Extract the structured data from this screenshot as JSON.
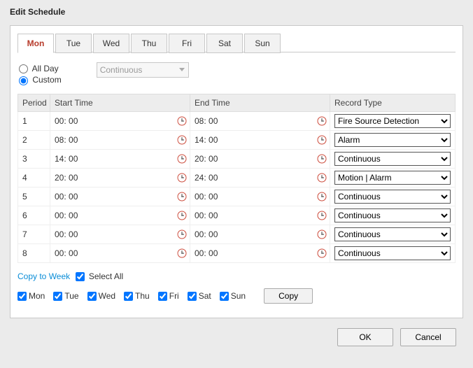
{
  "window": {
    "title": "Edit Schedule"
  },
  "tabs": [
    {
      "label": "Mon",
      "id": "mon",
      "active": true
    },
    {
      "label": "Tue",
      "id": "tue",
      "active": false
    },
    {
      "label": "Wed",
      "id": "wed",
      "active": false
    },
    {
      "label": "Thu",
      "id": "thu",
      "active": false
    },
    {
      "label": "Fri",
      "id": "fri",
      "active": false
    },
    {
      "label": "Sat",
      "id": "sat",
      "active": false
    },
    {
      "label": "Sun",
      "id": "sun",
      "active": false
    }
  ],
  "mode": {
    "all_day_label": "All Day",
    "custom_label": "Custom",
    "selected": "custom",
    "all_day_type": "Continuous"
  },
  "headers": {
    "period": "Period",
    "start": "Start Time",
    "end": "End Time",
    "type": "Record Type"
  },
  "record_type_options": [
    "Continuous",
    "Alarm",
    "Motion | Alarm",
    "Fire Source Detection"
  ],
  "periods": [
    {
      "n": "1",
      "start": "00: 00",
      "end": "08: 00",
      "type": "Fire Source Detection"
    },
    {
      "n": "2",
      "start": "08: 00",
      "end": "14: 00",
      "type": "Alarm"
    },
    {
      "n": "3",
      "start": "14: 00",
      "end": "20: 00",
      "type": "Continuous"
    },
    {
      "n": "4",
      "start": "20: 00",
      "end": "24: 00",
      "type": "Motion | Alarm"
    },
    {
      "n": "5",
      "start": "00: 00",
      "end": "00: 00",
      "type": "Continuous"
    },
    {
      "n": "6",
      "start": "00: 00",
      "end": "00: 00",
      "type": "Continuous"
    },
    {
      "n": "7",
      "start": "00: 00",
      "end": "00: 00",
      "type": "Continuous"
    },
    {
      "n": "8",
      "start": "00: 00",
      "end": "00: 00",
      "type": "Continuous"
    }
  ],
  "copy": {
    "link": "Copy to Week",
    "select_all_label": "Select All",
    "select_all_checked": true,
    "days": [
      {
        "label": "Mon",
        "checked": true
      },
      {
        "label": "Tue",
        "checked": true
      },
      {
        "label": "Wed",
        "checked": true
      },
      {
        "label": "Thu",
        "checked": true
      },
      {
        "label": "Fri",
        "checked": true
      },
      {
        "label": "Sat",
        "checked": true
      },
      {
        "label": "Sun",
        "checked": true
      }
    ],
    "button": "Copy"
  },
  "footer": {
    "ok": "OK",
    "cancel": "Cancel"
  }
}
